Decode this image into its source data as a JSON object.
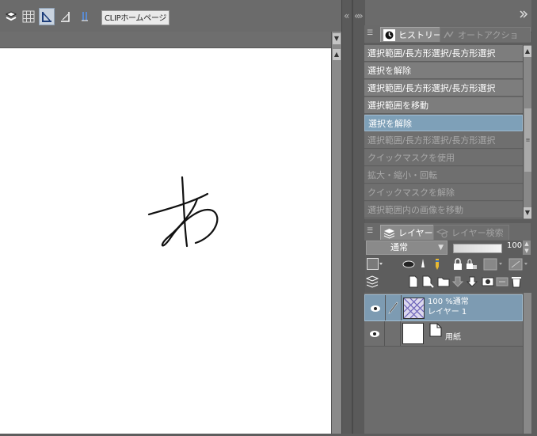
{
  "toolbar": {
    "clip_homepage_label": "CLIPホームページ",
    "icons": [
      "layers-icon",
      "grid-icon",
      "ruler-icon",
      "ruler-snap-icon",
      "special-ruler-icon"
    ]
  },
  "splitter": {
    "collapse_left": "«",
    "collapse_right": "«»"
  },
  "history": {
    "tab_active": "ヒストリー",
    "tab_inactive": "オートアクション",
    "items": [
      {
        "label": "選択範囲/長方形選択/長方形選択",
        "state": "done"
      },
      {
        "label": "選択を解除",
        "state": "done"
      },
      {
        "label": "選択範囲/長方形選択/長方形選択",
        "state": "done"
      },
      {
        "label": "選択範囲を移動",
        "state": "done"
      },
      {
        "label": "選択を解除",
        "state": "selected"
      },
      {
        "label": "選択範囲/長方形選択/長方形選択",
        "state": "undone"
      },
      {
        "label": "クイックマスクを使用",
        "state": "undone"
      },
      {
        "label": "拡大・縮小・回転",
        "state": "undone"
      },
      {
        "label": "クイックマスクを解除",
        "state": "undone"
      },
      {
        "label": "選択範囲内の画像を移動",
        "state": "undone"
      }
    ]
  },
  "layers": {
    "tab_active": "レイヤー",
    "tab_inactive": "レイヤー検索",
    "blend_mode": "通常",
    "opacity": "100",
    "opacity_fraction": 1.0,
    "items": [
      {
        "line1": "100 %通常",
        "line2": "レイヤー 1",
        "selected": true
      },
      {
        "line1": "",
        "line2": "用紙",
        "selected": false
      }
    ]
  },
  "colors": {
    "selection": "#7ea0b8",
    "panel_bg": "#6c6c6c"
  }
}
